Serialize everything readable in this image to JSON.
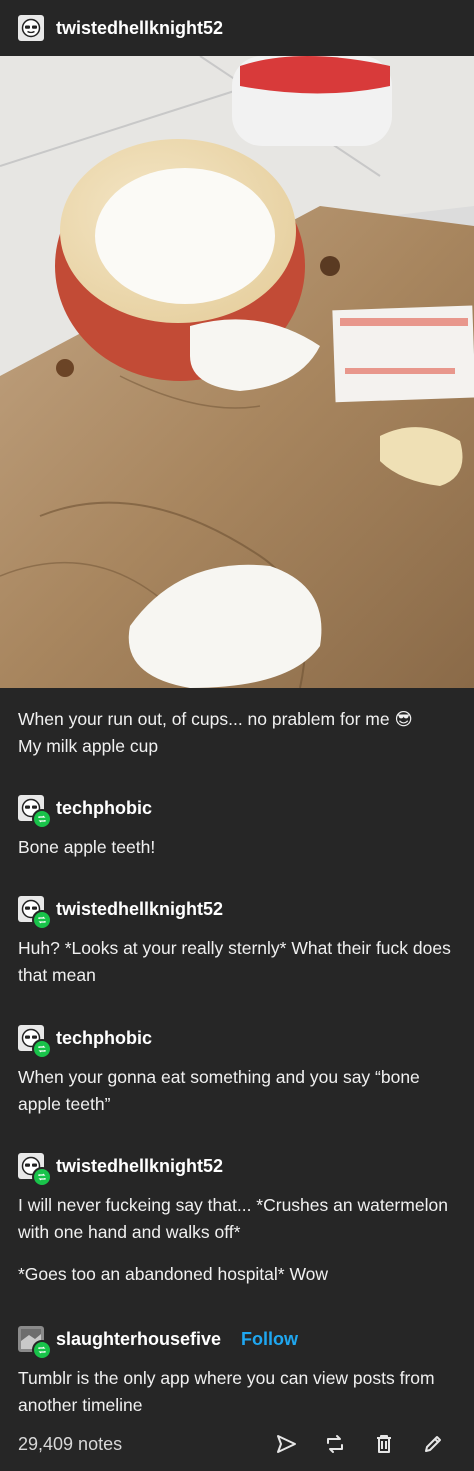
{
  "header": {
    "username": "twistedhellknight52"
  },
  "photo": {
    "label": "essential health fabric strips"
  },
  "caption": {
    "line1": "When your run out, of cups... no prablem for me",
    "emoji": "😎",
    "line2": "My milk apple cup"
  },
  "reblogs": [
    {
      "username": "techphobic",
      "text": "Bone apple teeth!"
    },
    {
      "username": "twistedhellknight52",
      "text": "Huh? *Looks at your really sternly* What their fuck does that mean"
    },
    {
      "username": "techphobic",
      "text": "When your gonna eat something and you say “bone apple teeth”"
    },
    {
      "username": "twistedhellknight52",
      "text": "I will never fuckeing say that... *Crushes an watermelon with one hand and walks off*",
      "text2": "*Goes too an abandoned hospital* Wow"
    },
    {
      "username": "slaughterhousefive",
      "follow": "Follow",
      "text": "Tumblr is the only app where you can view posts from another timeline"
    }
  ],
  "footer": {
    "notes": "29,409 notes"
  },
  "icons": [
    "sunglasses-avatar-icon",
    "reblog-icon",
    "send-icon",
    "delete-icon",
    "edit-icon"
  ],
  "colors": {
    "background": "#262626",
    "follow": "#1fa7f0",
    "reblog_badge": "#19c34a"
  }
}
